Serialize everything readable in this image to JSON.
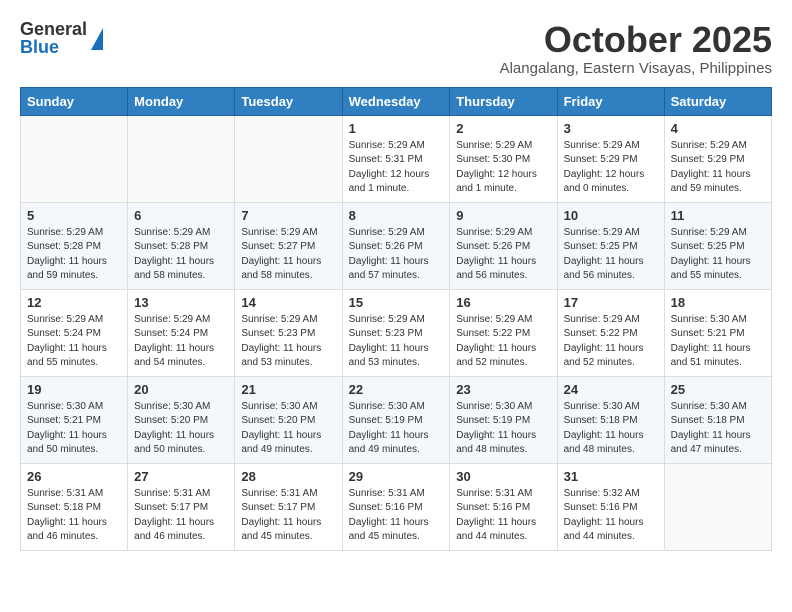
{
  "header": {
    "logo_general": "General",
    "logo_blue": "Blue",
    "month_title": "October 2025",
    "location": "Alangalang, Eastern Visayas, Philippines"
  },
  "weekdays": [
    "Sunday",
    "Monday",
    "Tuesday",
    "Wednesday",
    "Thursday",
    "Friday",
    "Saturday"
  ],
  "weeks": [
    [
      {
        "day": "",
        "info": ""
      },
      {
        "day": "",
        "info": ""
      },
      {
        "day": "",
        "info": ""
      },
      {
        "day": "1",
        "info": "Sunrise: 5:29 AM\nSunset: 5:31 PM\nDaylight: 12 hours\nand 1 minute."
      },
      {
        "day": "2",
        "info": "Sunrise: 5:29 AM\nSunset: 5:30 PM\nDaylight: 12 hours\nand 1 minute."
      },
      {
        "day": "3",
        "info": "Sunrise: 5:29 AM\nSunset: 5:29 PM\nDaylight: 12 hours\nand 0 minutes."
      },
      {
        "day": "4",
        "info": "Sunrise: 5:29 AM\nSunset: 5:29 PM\nDaylight: 11 hours\nand 59 minutes."
      }
    ],
    [
      {
        "day": "5",
        "info": "Sunrise: 5:29 AM\nSunset: 5:28 PM\nDaylight: 11 hours\nand 59 minutes."
      },
      {
        "day": "6",
        "info": "Sunrise: 5:29 AM\nSunset: 5:28 PM\nDaylight: 11 hours\nand 58 minutes."
      },
      {
        "day": "7",
        "info": "Sunrise: 5:29 AM\nSunset: 5:27 PM\nDaylight: 11 hours\nand 58 minutes."
      },
      {
        "day": "8",
        "info": "Sunrise: 5:29 AM\nSunset: 5:26 PM\nDaylight: 11 hours\nand 57 minutes."
      },
      {
        "day": "9",
        "info": "Sunrise: 5:29 AM\nSunset: 5:26 PM\nDaylight: 11 hours\nand 56 minutes."
      },
      {
        "day": "10",
        "info": "Sunrise: 5:29 AM\nSunset: 5:25 PM\nDaylight: 11 hours\nand 56 minutes."
      },
      {
        "day": "11",
        "info": "Sunrise: 5:29 AM\nSunset: 5:25 PM\nDaylight: 11 hours\nand 55 minutes."
      }
    ],
    [
      {
        "day": "12",
        "info": "Sunrise: 5:29 AM\nSunset: 5:24 PM\nDaylight: 11 hours\nand 55 minutes."
      },
      {
        "day": "13",
        "info": "Sunrise: 5:29 AM\nSunset: 5:24 PM\nDaylight: 11 hours\nand 54 minutes."
      },
      {
        "day": "14",
        "info": "Sunrise: 5:29 AM\nSunset: 5:23 PM\nDaylight: 11 hours\nand 53 minutes."
      },
      {
        "day": "15",
        "info": "Sunrise: 5:29 AM\nSunset: 5:23 PM\nDaylight: 11 hours\nand 53 minutes."
      },
      {
        "day": "16",
        "info": "Sunrise: 5:29 AM\nSunset: 5:22 PM\nDaylight: 11 hours\nand 52 minutes."
      },
      {
        "day": "17",
        "info": "Sunrise: 5:29 AM\nSunset: 5:22 PM\nDaylight: 11 hours\nand 52 minutes."
      },
      {
        "day": "18",
        "info": "Sunrise: 5:30 AM\nSunset: 5:21 PM\nDaylight: 11 hours\nand 51 minutes."
      }
    ],
    [
      {
        "day": "19",
        "info": "Sunrise: 5:30 AM\nSunset: 5:21 PM\nDaylight: 11 hours\nand 50 minutes."
      },
      {
        "day": "20",
        "info": "Sunrise: 5:30 AM\nSunset: 5:20 PM\nDaylight: 11 hours\nand 50 minutes."
      },
      {
        "day": "21",
        "info": "Sunrise: 5:30 AM\nSunset: 5:20 PM\nDaylight: 11 hours\nand 49 minutes."
      },
      {
        "day": "22",
        "info": "Sunrise: 5:30 AM\nSunset: 5:19 PM\nDaylight: 11 hours\nand 49 minutes."
      },
      {
        "day": "23",
        "info": "Sunrise: 5:30 AM\nSunset: 5:19 PM\nDaylight: 11 hours\nand 48 minutes."
      },
      {
        "day": "24",
        "info": "Sunrise: 5:30 AM\nSunset: 5:18 PM\nDaylight: 11 hours\nand 48 minutes."
      },
      {
        "day": "25",
        "info": "Sunrise: 5:30 AM\nSunset: 5:18 PM\nDaylight: 11 hours\nand 47 minutes."
      }
    ],
    [
      {
        "day": "26",
        "info": "Sunrise: 5:31 AM\nSunset: 5:18 PM\nDaylight: 11 hours\nand 46 minutes."
      },
      {
        "day": "27",
        "info": "Sunrise: 5:31 AM\nSunset: 5:17 PM\nDaylight: 11 hours\nand 46 minutes."
      },
      {
        "day": "28",
        "info": "Sunrise: 5:31 AM\nSunset: 5:17 PM\nDaylight: 11 hours\nand 45 minutes."
      },
      {
        "day": "29",
        "info": "Sunrise: 5:31 AM\nSunset: 5:16 PM\nDaylight: 11 hours\nand 45 minutes."
      },
      {
        "day": "30",
        "info": "Sunrise: 5:31 AM\nSunset: 5:16 PM\nDaylight: 11 hours\nand 44 minutes."
      },
      {
        "day": "31",
        "info": "Sunrise: 5:32 AM\nSunset: 5:16 PM\nDaylight: 11 hours\nand 44 minutes."
      },
      {
        "day": "",
        "info": ""
      }
    ]
  ]
}
